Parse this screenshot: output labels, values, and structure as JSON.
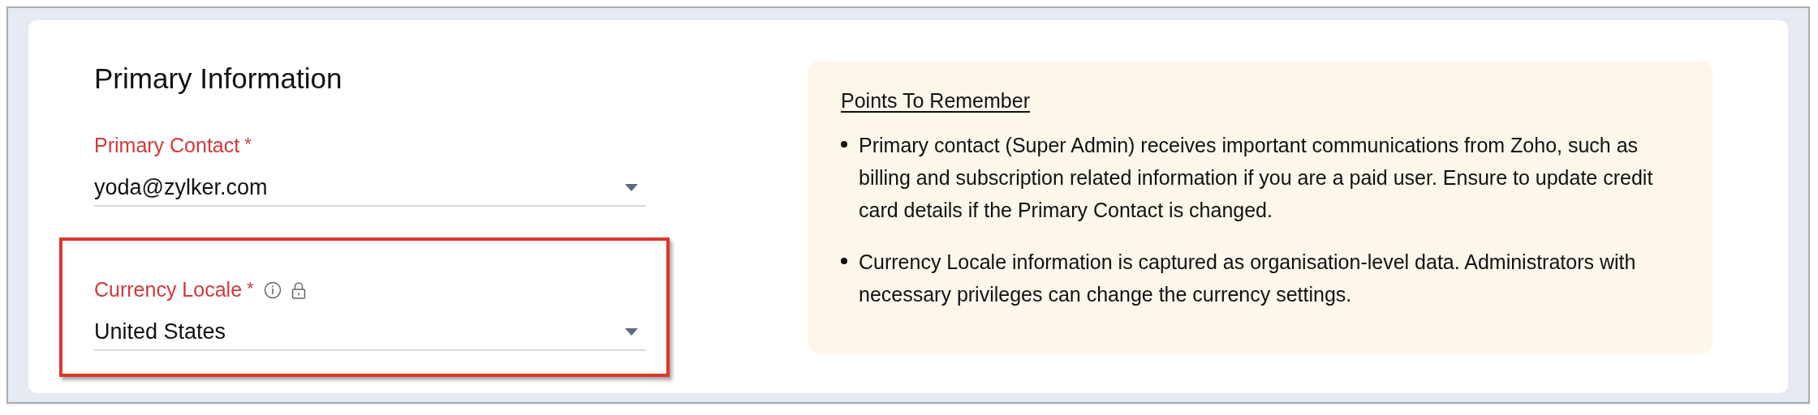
{
  "section": {
    "title": "Primary Information"
  },
  "fields": [
    {
      "label": "Primary Contact",
      "required_mark": "*",
      "value": "yoda@zylker.com",
      "info_icon": false,
      "locked": false,
      "highlighted": false
    },
    {
      "label": "Currency Locale",
      "required_mark": "*",
      "value": "United States",
      "info_icon": true,
      "locked": true,
      "highlighted": true
    }
  ],
  "notes": {
    "title": "Points To Remember",
    "items": [
      "Primary contact (Super Admin) receives important communications from Zoho, such as billing and subscription related information if you are a paid user. Ensure to update credit card details if the Primary Contact is changed.",
      "Currency Locale information is captured as organisation-level data. Administrators with necessary privileges can change the currency settings."
    ]
  }
}
